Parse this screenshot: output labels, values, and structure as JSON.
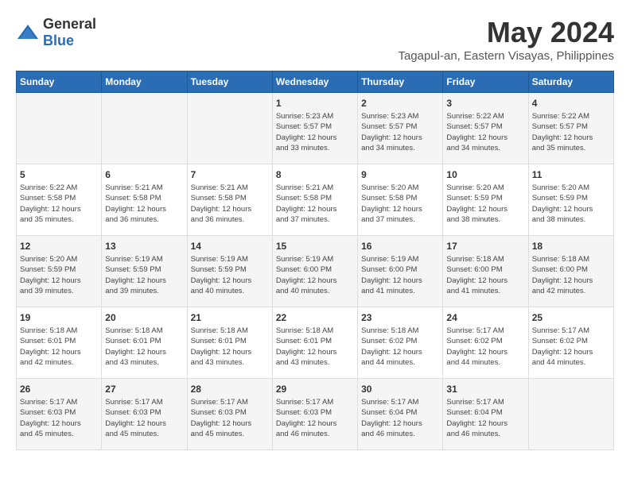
{
  "logo": {
    "general": "General",
    "blue": "Blue"
  },
  "title": "May 2024",
  "subtitle": "Tagapul-an, Eastern Visayas, Philippines",
  "days_of_week": [
    "Sunday",
    "Monday",
    "Tuesday",
    "Wednesday",
    "Thursday",
    "Friday",
    "Saturday"
  ],
  "weeks": [
    [
      {
        "day": "",
        "content": ""
      },
      {
        "day": "",
        "content": ""
      },
      {
        "day": "",
        "content": ""
      },
      {
        "day": "1",
        "content": "Sunrise: 5:23 AM\nSunset: 5:57 PM\nDaylight: 12 hours\nand 33 minutes."
      },
      {
        "day": "2",
        "content": "Sunrise: 5:23 AM\nSunset: 5:57 PM\nDaylight: 12 hours\nand 34 minutes."
      },
      {
        "day": "3",
        "content": "Sunrise: 5:22 AM\nSunset: 5:57 PM\nDaylight: 12 hours\nand 34 minutes."
      },
      {
        "day": "4",
        "content": "Sunrise: 5:22 AM\nSunset: 5:57 PM\nDaylight: 12 hours\nand 35 minutes."
      }
    ],
    [
      {
        "day": "5",
        "content": "Sunrise: 5:22 AM\nSunset: 5:58 PM\nDaylight: 12 hours\nand 35 minutes."
      },
      {
        "day": "6",
        "content": "Sunrise: 5:21 AM\nSunset: 5:58 PM\nDaylight: 12 hours\nand 36 minutes."
      },
      {
        "day": "7",
        "content": "Sunrise: 5:21 AM\nSunset: 5:58 PM\nDaylight: 12 hours\nand 36 minutes."
      },
      {
        "day": "8",
        "content": "Sunrise: 5:21 AM\nSunset: 5:58 PM\nDaylight: 12 hours\nand 37 minutes."
      },
      {
        "day": "9",
        "content": "Sunrise: 5:20 AM\nSunset: 5:58 PM\nDaylight: 12 hours\nand 37 minutes."
      },
      {
        "day": "10",
        "content": "Sunrise: 5:20 AM\nSunset: 5:59 PM\nDaylight: 12 hours\nand 38 minutes."
      },
      {
        "day": "11",
        "content": "Sunrise: 5:20 AM\nSunset: 5:59 PM\nDaylight: 12 hours\nand 38 minutes."
      }
    ],
    [
      {
        "day": "12",
        "content": "Sunrise: 5:20 AM\nSunset: 5:59 PM\nDaylight: 12 hours\nand 39 minutes."
      },
      {
        "day": "13",
        "content": "Sunrise: 5:19 AM\nSunset: 5:59 PM\nDaylight: 12 hours\nand 39 minutes."
      },
      {
        "day": "14",
        "content": "Sunrise: 5:19 AM\nSunset: 5:59 PM\nDaylight: 12 hours\nand 40 minutes."
      },
      {
        "day": "15",
        "content": "Sunrise: 5:19 AM\nSunset: 6:00 PM\nDaylight: 12 hours\nand 40 minutes."
      },
      {
        "day": "16",
        "content": "Sunrise: 5:19 AM\nSunset: 6:00 PM\nDaylight: 12 hours\nand 41 minutes."
      },
      {
        "day": "17",
        "content": "Sunrise: 5:18 AM\nSunset: 6:00 PM\nDaylight: 12 hours\nand 41 minutes."
      },
      {
        "day": "18",
        "content": "Sunrise: 5:18 AM\nSunset: 6:00 PM\nDaylight: 12 hours\nand 42 minutes."
      }
    ],
    [
      {
        "day": "19",
        "content": "Sunrise: 5:18 AM\nSunset: 6:01 PM\nDaylight: 12 hours\nand 42 minutes."
      },
      {
        "day": "20",
        "content": "Sunrise: 5:18 AM\nSunset: 6:01 PM\nDaylight: 12 hours\nand 43 minutes."
      },
      {
        "day": "21",
        "content": "Sunrise: 5:18 AM\nSunset: 6:01 PM\nDaylight: 12 hours\nand 43 minutes."
      },
      {
        "day": "22",
        "content": "Sunrise: 5:18 AM\nSunset: 6:01 PM\nDaylight: 12 hours\nand 43 minutes."
      },
      {
        "day": "23",
        "content": "Sunrise: 5:18 AM\nSunset: 6:02 PM\nDaylight: 12 hours\nand 44 minutes."
      },
      {
        "day": "24",
        "content": "Sunrise: 5:17 AM\nSunset: 6:02 PM\nDaylight: 12 hours\nand 44 minutes."
      },
      {
        "day": "25",
        "content": "Sunrise: 5:17 AM\nSunset: 6:02 PM\nDaylight: 12 hours\nand 44 minutes."
      }
    ],
    [
      {
        "day": "26",
        "content": "Sunrise: 5:17 AM\nSunset: 6:03 PM\nDaylight: 12 hours\nand 45 minutes."
      },
      {
        "day": "27",
        "content": "Sunrise: 5:17 AM\nSunset: 6:03 PM\nDaylight: 12 hours\nand 45 minutes."
      },
      {
        "day": "28",
        "content": "Sunrise: 5:17 AM\nSunset: 6:03 PM\nDaylight: 12 hours\nand 45 minutes."
      },
      {
        "day": "29",
        "content": "Sunrise: 5:17 AM\nSunset: 6:03 PM\nDaylight: 12 hours\nand 46 minutes."
      },
      {
        "day": "30",
        "content": "Sunrise: 5:17 AM\nSunset: 6:04 PM\nDaylight: 12 hours\nand 46 minutes."
      },
      {
        "day": "31",
        "content": "Sunrise: 5:17 AM\nSunset: 6:04 PM\nDaylight: 12 hours\nand 46 minutes."
      },
      {
        "day": "",
        "content": ""
      }
    ]
  ]
}
